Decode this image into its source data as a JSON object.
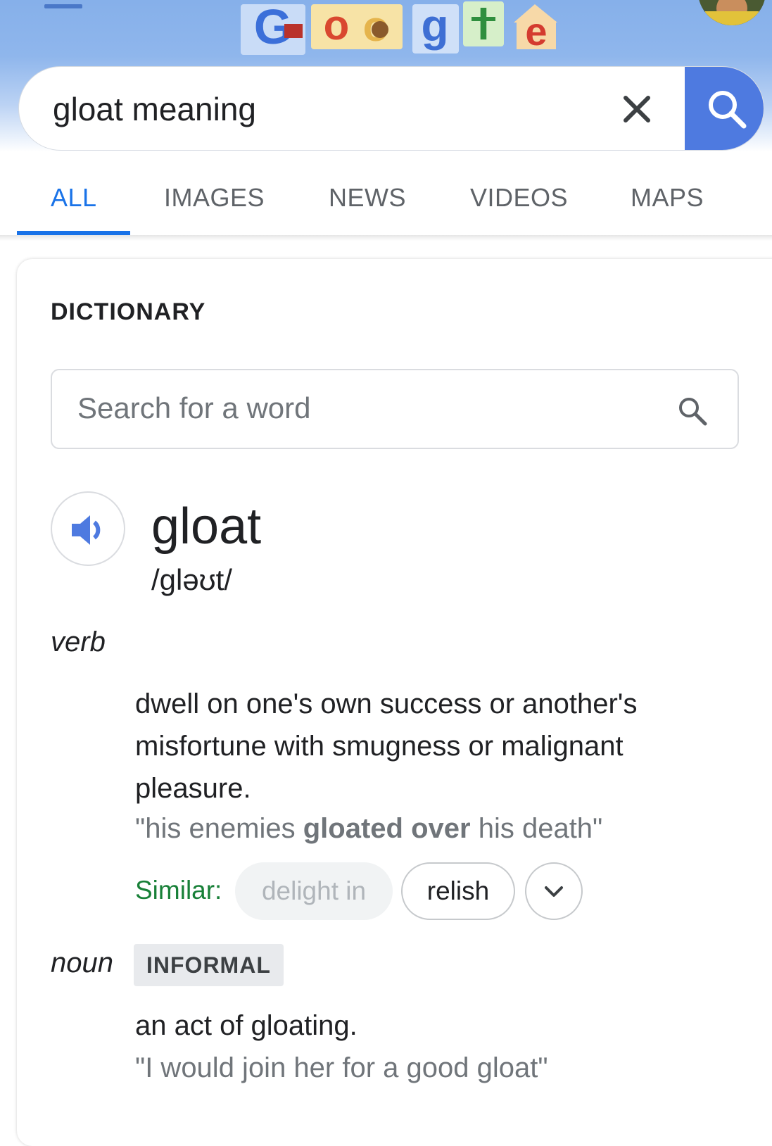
{
  "header": {
    "search_query": "gloat meaning",
    "doodle_alt": "Google"
  },
  "tabs": [
    {
      "label": "ALL",
      "active": true
    },
    {
      "label": "IMAGES"
    },
    {
      "label": "NEWS"
    },
    {
      "label": "VIDEOS"
    },
    {
      "label": "MAPS"
    }
  ],
  "dictionary": {
    "heading": "DICTIONARY",
    "search_placeholder": "Search for a word",
    "word": "gloat",
    "phonetic": "/gləʊt/",
    "verb": {
      "pos": "verb",
      "definition": "dwell on one's own success or another's misfortune with smugness or malignant pleasure.",
      "example_before": "\"his enemies ",
      "example_bold": "gloated over",
      "example_after": " his death\"",
      "similar_label": "Similar:",
      "similar": [
        "delight in",
        "relish"
      ]
    },
    "noun": {
      "pos": "noun",
      "tag": "INFORMAL",
      "definition": "an act of gloating.",
      "example": "\"I would join her for a good gloat\""
    }
  },
  "colors": {
    "accent": "#1a73e8",
    "search_button": "#4e7ae0",
    "similar_label": "#188038",
    "muted_text": "#70757a"
  },
  "icons": [
    "menu-icon",
    "clear-icon",
    "search-icon",
    "speaker-icon",
    "chevron-down-icon"
  ]
}
